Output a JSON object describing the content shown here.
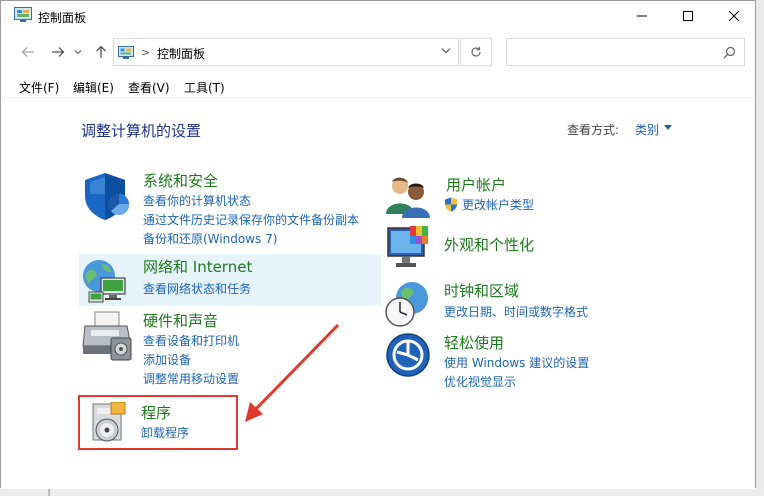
{
  "window": {
    "title": "控制面板"
  },
  "nav": {
    "address_text": "控制面板",
    "address_sep": ">",
    "search_placeholder": ""
  },
  "menu": {
    "items": [
      "文件(F)",
      "编辑(E)",
      "查看(V)",
      "工具(T)"
    ]
  },
  "main": {
    "heading": "调整计算机的设置",
    "view_by_label": "查看方式:",
    "view_by_value": "类别"
  },
  "categories": [
    {
      "title": "系统和安全",
      "links": [
        "查看你的计算机状态",
        "通过文件历史记录保存你的文件备份副本",
        "备份和还原(Windows 7)"
      ]
    },
    {
      "title": "网络和 Internet",
      "links": [
        "查看网络状态和任务"
      ]
    },
    {
      "title": "硬件和声音",
      "links": [
        "查看设备和打印机",
        "添加设备",
        "调整常用移动设置"
      ]
    },
    {
      "title": "程序",
      "links": [
        "卸载程序"
      ]
    },
    {
      "title": "用户帐户",
      "links": [
        "更改帐户类型"
      ]
    },
    {
      "title": "外观和个性化",
      "links": []
    },
    {
      "title": "时钟和区域",
      "links": [
        "更改日期、时间或数字格式"
      ]
    },
    {
      "title": "轻松使用",
      "links": [
        "使用 Windows 建议的设置",
        "优化视觉显示"
      ]
    }
  ],
  "colors": {
    "category_title": "#1d7a1d",
    "link": "#1d64b4",
    "heading": "#1e3287",
    "highlight_bg": "#e7f3fb",
    "annotation_red": "#e03a2d"
  },
  "icons": {
    "system_security": "shield-icon",
    "network": "globe-network-icon",
    "hardware": "printer-icon",
    "programs": "programs-disc-icon",
    "user_accounts": "users-icon",
    "appearance": "monitor-color-icon",
    "clock_region": "clock-globe-icon",
    "ease_of_access": "accessibility-icon"
  }
}
